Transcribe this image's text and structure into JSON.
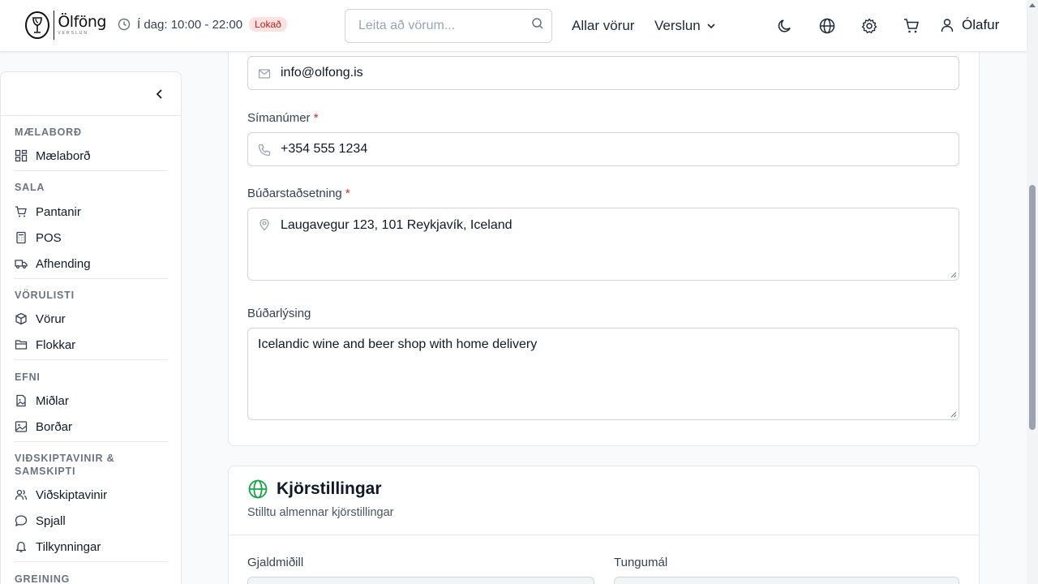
{
  "header": {
    "logo": {
      "name": "Ölföng",
      "tagline": "VERSLUN",
      "icon": "wine-glass-logo"
    },
    "hours_label": "Í dag: 10:00 - 22:00",
    "status_badge": "Lokað",
    "search_placeholder": "Leita að vörum...",
    "nav": {
      "all_products": "Allar vörur",
      "store": "Verslun"
    },
    "icons": [
      "moon-icon",
      "globe-icon",
      "gear-icon",
      "cart-icon"
    ],
    "user_name": "Ólafur"
  },
  "sidebar": {
    "sections": [
      {
        "title": "MÆLABORÐ",
        "items": [
          {
            "label": "Mælaborð",
            "icon": "dashboard-icon"
          }
        ]
      },
      {
        "title": "SALA",
        "items": [
          {
            "label": "Pantanir",
            "icon": "cart-icon"
          },
          {
            "label": "POS",
            "icon": "calculator-icon"
          },
          {
            "label": "Afhending",
            "icon": "truck-icon"
          }
        ]
      },
      {
        "title": "VÖRULISTI",
        "items": [
          {
            "label": "Vörur",
            "icon": "package-icon"
          },
          {
            "label": "Flokkar",
            "icon": "folder-icon"
          }
        ]
      },
      {
        "title": "EFNI",
        "items": [
          {
            "label": "Miðlar",
            "icon": "file-image-icon"
          },
          {
            "label": "Borðar",
            "icon": "image-icon"
          }
        ]
      },
      {
        "title_line1": "VIÐSKIPTAVINIR &",
        "title_line2": "SAMSKIPTI",
        "items": [
          {
            "label": "Viðskiptavinir",
            "icon": "users-icon"
          },
          {
            "label": "Spjall",
            "icon": "chat-icon"
          },
          {
            "label": "Tilkynningar",
            "icon": "bell-icon"
          }
        ]
      },
      {
        "title": "GREINING"
      }
    ]
  },
  "form": {
    "email_value": "info@olfong.is",
    "phone_label": "Símanúmer",
    "phone_value": "+354 555 1234",
    "address_label": "Búðarstaðsetning",
    "address_value": "Laugavegur 123, 101 Reykjavík, Iceland",
    "description_label": "Búðarlýsing",
    "description_value": "Icelandic wine and beer shop with home delivery",
    "required_mark": "*"
  },
  "run_settings": {
    "title": "Kjörstillingar",
    "subtitle": "Stilltu almennar kjörstillingar",
    "currency_label": "Gjaldmiðill",
    "language_label": "Tungumál"
  },
  "colors": {
    "accent_green": "#16a34a",
    "required_red": "#dc2626",
    "badge_bg": "#fee2e2",
    "badge_text": "#b91c1c"
  }
}
